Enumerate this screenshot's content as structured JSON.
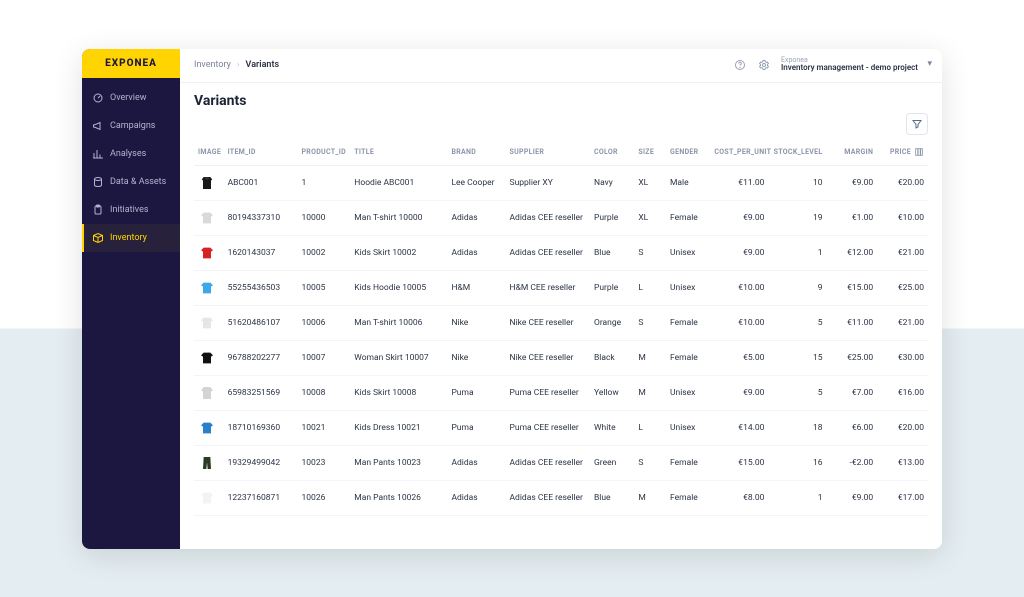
{
  "brand": "EXPONEA",
  "project": {
    "label": "Exponea",
    "value": "Inventory management - demo project"
  },
  "breadcrumbs": {
    "parent": "Inventory",
    "current": "Variants"
  },
  "page": {
    "title": "Variants"
  },
  "sidebar": {
    "items": [
      {
        "label": "Overview",
        "icon": "overview"
      },
      {
        "label": "Campaigns",
        "icon": "megaphone"
      },
      {
        "label": "Analyses",
        "icon": "chart"
      },
      {
        "label": "Data & Assets",
        "icon": "database"
      },
      {
        "label": "Initiatives",
        "icon": "clipboard"
      },
      {
        "label": "Inventory",
        "icon": "box",
        "active": true
      }
    ]
  },
  "columns": {
    "image": "IMAGE",
    "item_id": "ITEM_ID",
    "product_id": "PRODUCT_ID",
    "title": "TITLE",
    "brand": "BRAND",
    "supplier": "SUPPLIER",
    "color": "COLOR",
    "size": "SIZE",
    "gender": "GENDER",
    "cpu": "COST_PER_UNIT",
    "stock": "STOCK_LEVEL",
    "margin": "MARGIN",
    "price": "PRICE"
  },
  "rows": [
    {
      "thumb": {
        "type": "hoodie",
        "fill": "#1a1a1a"
      },
      "item_id": "ABC001",
      "product_id": "1",
      "title": "Hoodie ABC001",
      "brand": "Lee Cooper",
      "supplier": "Supplier XY",
      "color": "Navy",
      "size": "XL",
      "gender": "Male",
      "cpu": "€11.00",
      "stock": "10",
      "margin": "€9.00",
      "price": "€20.00"
    },
    {
      "thumb": {
        "type": "tshirt",
        "fill": "#d9d9d9"
      },
      "item_id": "80194337310",
      "product_id": "10000",
      "title": "Man T-shirt 10000",
      "brand": "Adidas",
      "supplier": "Adidas CEE reseller",
      "color": "Purple",
      "size": "XL",
      "gender": "Female",
      "cpu": "€9.00",
      "stock": "19",
      "margin": "€1.00",
      "price": "€10.00"
    },
    {
      "thumb": {
        "type": "tshirt",
        "fill": "#d62222"
      },
      "item_id": "1620143037",
      "product_id": "10002",
      "title": "Kids Skirt 10002",
      "brand": "Adidas",
      "supplier": "Adidas CEE reseller",
      "color": "Blue",
      "size": "S",
      "gender": "Unisex",
      "cpu": "€9.00",
      "stock": "1",
      "margin": "€12.00",
      "price": "€21.00"
    },
    {
      "thumb": {
        "type": "tshirt",
        "fill": "#3ba9e6"
      },
      "item_id": "55255436503",
      "product_id": "10005",
      "title": "Kids Hoodie 10005",
      "brand": "H&M",
      "supplier": "H&M CEE reseller",
      "color": "Purple",
      "size": "L",
      "gender": "Unisex",
      "cpu": "€10.00",
      "stock": "9",
      "margin": "€15.00",
      "price": "€25.00"
    },
    {
      "thumb": {
        "type": "tshirt",
        "fill": "#e6e6e6"
      },
      "item_id": "51620486107",
      "product_id": "10006",
      "title": "Man T-shirt 10006",
      "brand": "Nike",
      "supplier": "Nike CEE reseller",
      "color": "Orange",
      "size": "S",
      "gender": "Female",
      "cpu": "€10.00",
      "stock": "5",
      "margin": "€11.00",
      "price": "€21.00"
    },
    {
      "thumb": {
        "type": "tshirt",
        "fill": "#111"
      },
      "item_id": "96788202277",
      "product_id": "10007",
      "title": "Woman Skirt 10007",
      "brand": "Nike",
      "supplier": "Nike CEE reseller",
      "color": "Black",
      "size": "M",
      "gender": "Female",
      "cpu": "€5.00",
      "stock": "15",
      "margin": "€25.00",
      "price": "€30.00"
    },
    {
      "thumb": {
        "type": "long",
        "fill": "#d4d4d4"
      },
      "item_id": "65983251569",
      "product_id": "10008",
      "title": "Kids Skirt 10008",
      "brand": "Puma",
      "supplier": "Puma CEE reseller",
      "color": "Yellow",
      "size": "M",
      "gender": "Unisex",
      "cpu": "€9.00",
      "stock": "5",
      "margin": "€7.00",
      "price": "€16.00"
    },
    {
      "thumb": {
        "type": "tshirt",
        "fill": "#2b7ec9"
      },
      "item_id": "18710169360",
      "product_id": "10021",
      "title": "Kids Dress 10021",
      "brand": "Puma",
      "supplier": "Puma CEE reseller",
      "color": "White",
      "size": "L",
      "gender": "Unisex",
      "cpu": "€14.00",
      "stock": "18",
      "margin": "€6.00",
      "price": "€20.00"
    },
    {
      "thumb": {
        "type": "pants",
        "fill": "#2a3a24"
      },
      "item_id": "19329499042",
      "product_id": "10023",
      "title": "Man Pants 10023",
      "brand": "Adidas",
      "supplier": "Adidas CEE reseller",
      "color": "Green",
      "size": "S",
      "gender": "Female",
      "cpu": "€15.00",
      "stock": "16",
      "margin": "-€2.00",
      "price": "€13.00"
    },
    {
      "thumb": {
        "type": "tshirt",
        "fill": "#f3f3f3"
      },
      "item_id": "12237160871",
      "product_id": "10026",
      "title": "Man Pants 10026",
      "brand": "Adidas",
      "supplier": "Adidas CEE reseller",
      "color": "Blue",
      "size": "M",
      "gender": "Female",
      "cpu": "€8.00",
      "stock": "1",
      "margin": "€9.00",
      "price": "€17.00"
    }
  ]
}
